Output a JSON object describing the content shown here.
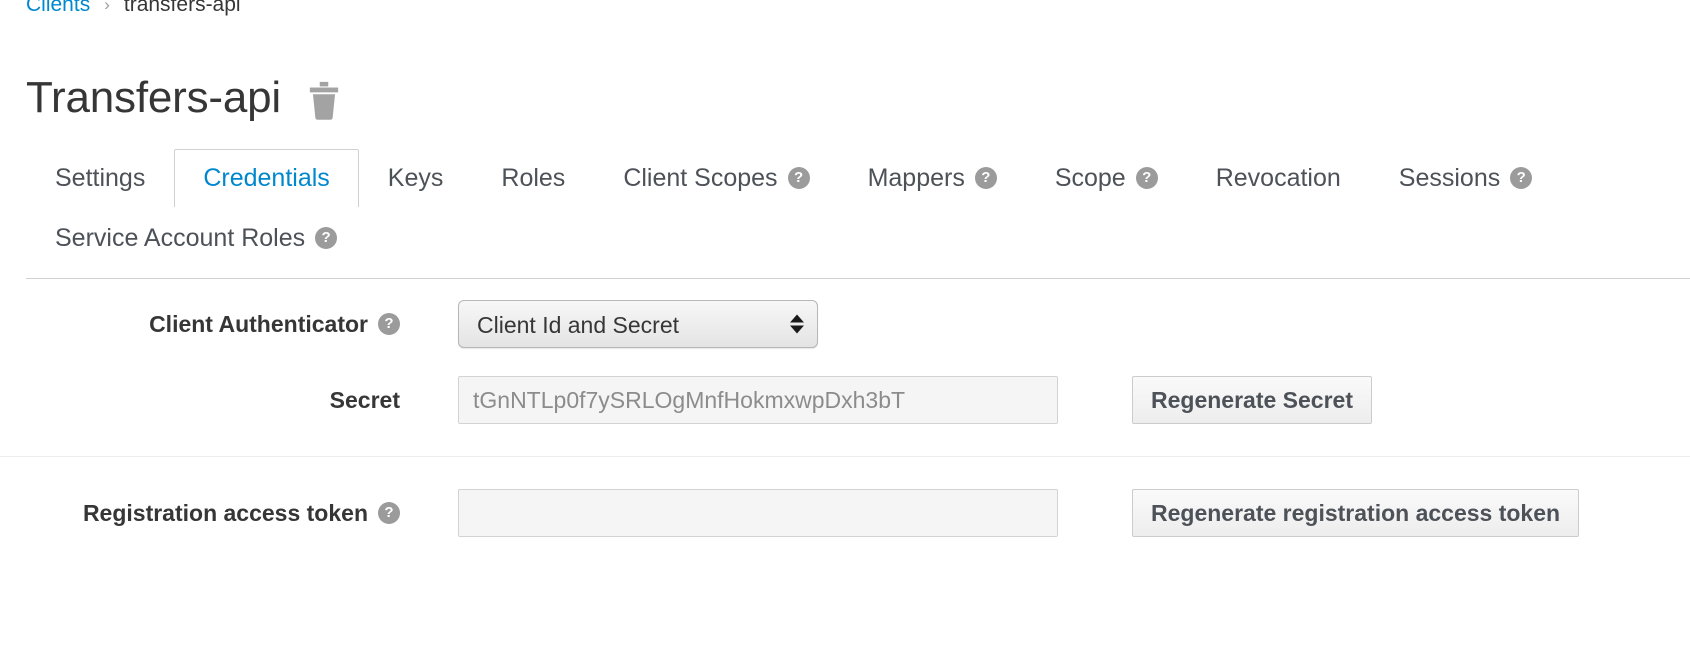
{
  "breadcrumb": {
    "parent_label": "Clients",
    "separator": "›",
    "current_label": "transfers-api"
  },
  "header": {
    "title": "Transfers-api",
    "delete_icon": "trash-icon"
  },
  "tabs": {
    "row1": [
      {
        "label": "Settings",
        "active": false,
        "help": false
      },
      {
        "label": "Credentials",
        "active": true,
        "help": false
      },
      {
        "label": "Keys",
        "active": false,
        "help": false
      },
      {
        "label": "Roles",
        "active": false,
        "help": false
      },
      {
        "label": "Client Scopes",
        "active": false,
        "help": true
      },
      {
        "label": "Mappers",
        "active": false,
        "help": true
      },
      {
        "label": "Scope",
        "active": false,
        "help": true
      },
      {
        "label": "Revocation",
        "active": false,
        "help": false
      },
      {
        "label": "Sessions",
        "active": false,
        "help": true
      }
    ],
    "row2": [
      {
        "label": "Service Account Roles",
        "active": false,
        "help": true
      }
    ],
    "help_glyph": "?",
    "active_color": "#0088ce"
  },
  "form": {
    "client_authenticator": {
      "label": "Client Authenticator",
      "help": "?",
      "selected": "Client Id and Secret",
      "options": [
        "Client Id and Secret"
      ]
    },
    "secret": {
      "label": "Secret",
      "value": "tGnNTLp0f7ySRLOgMnfHokmxwpDxh3bT",
      "button_label": "Regenerate Secret"
    },
    "registration_access_token": {
      "label": "Registration access token",
      "help": "?",
      "value": "",
      "placeholder": "",
      "button_label": "Regenerate registration access token"
    }
  },
  "colors": {
    "link": "#0088ce",
    "text": "#363636",
    "muted": "#8c8c8c",
    "border": "#d1d1d1",
    "help_bg": "#9b9b9b"
  }
}
